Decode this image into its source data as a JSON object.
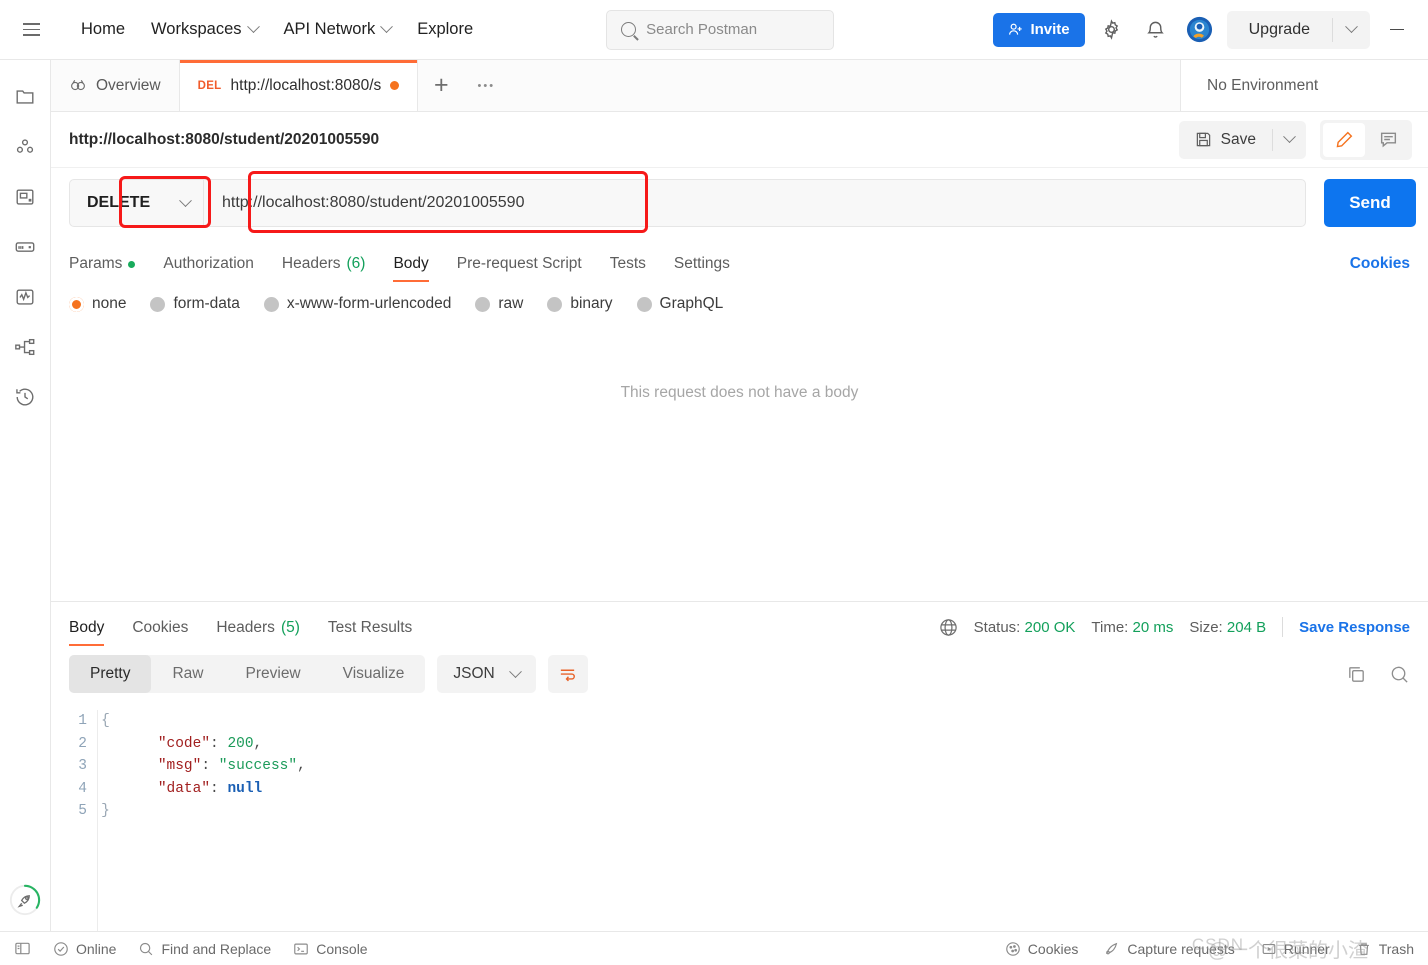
{
  "header": {
    "menu_icon": "hamburger-icon",
    "nav": [
      {
        "label": "Home",
        "has_caret": false
      },
      {
        "label": "Workspaces",
        "has_caret": true
      },
      {
        "label": "API Network",
        "has_caret": true
      },
      {
        "label": "Explore",
        "has_caret": false
      }
    ],
    "search": {
      "placeholder": "Search Postman",
      "icon": "search-icon"
    },
    "invite_label": "Invite",
    "settings_icon": "gear-icon",
    "notifications_icon": "bell-icon",
    "avatar_icon": "user-avatar-icon",
    "upgrade_label": "Upgrade",
    "minimize_icon": "minimize-icon"
  },
  "sidebar": {
    "items": [
      {
        "name": "collections",
        "icon": "collections-icon"
      },
      {
        "name": "environments",
        "icon": "environments-icon"
      },
      {
        "name": "mock-servers",
        "icon": "mock-server-icon"
      },
      {
        "name": "apis",
        "icon": "api-icon"
      },
      {
        "name": "monitors",
        "icon": "monitor-icon"
      },
      {
        "name": "flows",
        "icon": "flows-icon"
      },
      {
        "name": "history",
        "icon": "history-icon"
      }
    ],
    "bottom": {
      "name": "rocket",
      "icon": "rocket-icon"
    }
  },
  "tabs": {
    "items": [
      {
        "label": "Overview",
        "icon": "overview-icon",
        "active": false
      },
      {
        "verb": "DEL",
        "label": "http://localhost:8080/s",
        "unsaved": true,
        "active": true
      }
    ],
    "new_tab_label": "+",
    "more_label": "•••",
    "environment": "No Environment"
  },
  "request": {
    "title": "http://localhost:8080/student/20201005590",
    "save_label": "Save",
    "save_icon": "floppy-disk-icon",
    "edit_icon": "pencil-icon",
    "comment_icon": "comment-icon",
    "method": "DELETE",
    "url": "http://localhost:8080/student/20201005590",
    "send_label": "Send",
    "tabs": [
      {
        "label": "Params",
        "badge_dot": true,
        "active": false
      },
      {
        "label": "Authorization",
        "active": false
      },
      {
        "label": "Headers",
        "count": "(6)",
        "active": false
      },
      {
        "label": "Body",
        "active": true
      },
      {
        "label": "Pre-request Script",
        "active": false
      },
      {
        "label": "Tests",
        "active": false
      },
      {
        "label": "Settings",
        "active": false
      }
    ],
    "cookies_link": "Cookies",
    "body_types": [
      {
        "label": "none",
        "selected": true
      },
      {
        "label": "form-data",
        "selected": false
      },
      {
        "label": "x-www-form-urlencoded",
        "selected": false
      },
      {
        "label": "raw",
        "selected": false
      },
      {
        "label": "binary",
        "selected": false
      },
      {
        "label": "GraphQL",
        "selected": false
      }
    ],
    "body_empty_text": "This request does not have a body"
  },
  "response": {
    "tabs": [
      {
        "label": "Body",
        "active": true
      },
      {
        "label": "Cookies",
        "active": false
      },
      {
        "label": "Headers",
        "count": "(5)",
        "active": false
      },
      {
        "label": "Test Results",
        "active": false
      }
    ],
    "globe_icon": "globe-icon",
    "status_label": "Status:",
    "status_value": "200 OK",
    "time_label": "Time:",
    "time_value": "20 ms",
    "size_label": "Size:",
    "size_value": "204 B",
    "save_response_label": "Save Response",
    "view_modes": [
      {
        "label": "Pretty",
        "selected": true
      },
      {
        "label": "Raw",
        "selected": false
      },
      {
        "label": "Preview",
        "selected": false
      },
      {
        "label": "Visualize",
        "selected": false
      }
    ],
    "format": "JSON",
    "wrap_icon": "word-wrap-icon",
    "copy_icon": "copy-icon",
    "search_icon": "search-icon",
    "body_lines": [
      {
        "num": "1",
        "fold": "{",
        "segments": []
      },
      {
        "num": "2",
        "fold": "",
        "segments": [
          {
            "t": "    ",
            "c": "p"
          },
          {
            "t": "\"code\"",
            "c": "k"
          },
          {
            "t": ": ",
            "c": "p"
          },
          {
            "t": "200",
            "c": "n"
          },
          {
            "t": ",",
            "c": "p"
          }
        ]
      },
      {
        "num": "3",
        "fold": "",
        "segments": [
          {
            "t": "    ",
            "c": "p"
          },
          {
            "t": "\"msg\"",
            "c": "k"
          },
          {
            "t": ": ",
            "c": "p"
          },
          {
            "t": "\"success\"",
            "c": "s"
          },
          {
            "t": ",",
            "c": "p"
          }
        ]
      },
      {
        "num": "4",
        "fold": "",
        "segments": [
          {
            "t": "    ",
            "c": "p"
          },
          {
            "t": "\"data\"",
            "c": "k"
          },
          {
            "t": ": ",
            "c": "p"
          },
          {
            "t": "null",
            "c": "nul"
          }
        ]
      },
      {
        "num": "5",
        "fold": "}",
        "segments": []
      }
    ]
  },
  "statusbar": {
    "left": [
      {
        "label": "",
        "icon": "sidebar-toggle-icon"
      },
      {
        "label": "Online",
        "icon": "check-circle-icon"
      },
      {
        "label": "Find and Replace",
        "icon": "search-icon"
      },
      {
        "label": "Console",
        "icon": "terminal-icon"
      }
    ],
    "right": [
      {
        "label": "Cookies",
        "icon": "cookie-icon"
      },
      {
        "label": "Capture requests",
        "icon": "capture-icon"
      },
      {
        "label": "Runner",
        "icon": "runner-icon"
      },
      {
        "label": "Trash",
        "icon": "trash-icon"
      }
    ],
    "watermark": "@一个很菜的小渣",
    "watermark2": "CSDN"
  },
  "colors": {
    "accent": "#ff6c37",
    "blue": "#0d75ef",
    "green": "#13a05b",
    "annotation": "#f61919"
  }
}
